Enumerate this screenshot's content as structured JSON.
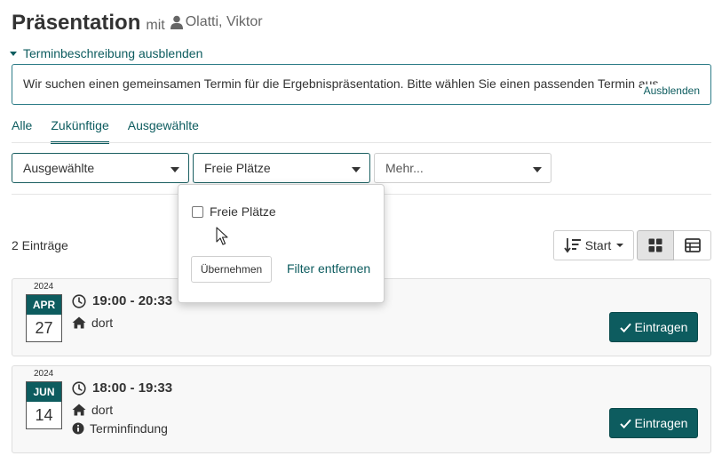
{
  "header": {
    "title": "Präsentation",
    "with_label": "mit",
    "owner": "Olatti, Viktor"
  },
  "description": {
    "toggle_label": "Terminbeschreibung ausblenden",
    "text": "Wir suchen einen gemeinsamen Termin für die Ergebnispräsentation. Bitte wählen Sie einen passenden Termin aus.",
    "hide_label": "Ausblenden"
  },
  "tabs": [
    {
      "label": "Alle",
      "active": false
    },
    {
      "label": "Zukünftige",
      "active": true
    },
    {
      "label": "Ausgewählte",
      "active": false
    }
  ],
  "filters": {
    "selected": "Ausgewählte",
    "free_places": "Freie Plätze",
    "more": "Mehr..."
  },
  "popover": {
    "checkbox_label": "Freie Plätze",
    "checked": false,
    "apply_label": "Übernehmen",
    "remove_label": "Filter entfernen"
  },
  "list": {
    "count_label": "2 Einträge",
    "sort_label": "Start",
    "view_modes": [
      "cards-icon",
      "table-icon"
    ],
    "active_view": "cards-icon"
  },
  "events": [
    {
      "year": "2024",
      "month": "APR",
      "day": "27",
      "time": "19:00 - 20:33",
      "location": "dort",
      "enroll_label": "Eintragen"
    },
    {
      "year": "2024",
      "month": "JUN",
      "day": "14",
      "time": "18:00 - 19:33",
      "location": "dort",
      "note": "Terminfindung",
      "enroll_label": "Eintragen"
    }
  ],
  "colors": {
    "accent": "#0d5c5f",
    "border_accent": "#2e7d88",
    "card_bg": "#f8f8f8"
  }
}
